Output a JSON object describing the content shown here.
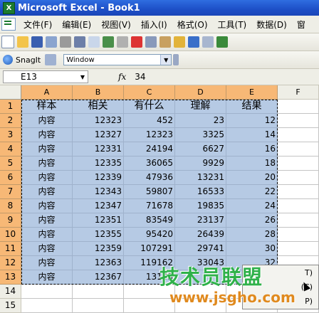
{
  "window": {
    "title": "Microsoft Excel - Book1"
  },
  "menu": [
    "文件(F)",
    "编辑(E)",
    "视图(V)",
    "插入(I)",
    "格式(O)",
    "工具(T)",
    "数据(D)",
    "窗"
  ],
  "snagit": {
    "label": "SnagIt",
    "capture_mode": "Window"
  },
  "formula": {
    "name_box": "E13",
    "fx_label": "fx",
    "value": "34"
  },
  "columns": [
    "A",
    "B",
    "C",
    "D",
    "E",
    "F"
  ],
  "rows": [
    "1",
    "2",
    "3",
    "4",
    "5",
    "6",
    "7",
    "8",
    "9",
    "10",
    "11",
    "12",
    "13",
    "14",
    "15"
  ],
  "table": {
    "headers": [
      "样本",
      "相关",
      "有什么",
      "理解",
      "结果"
    ],
    "data": [
      [
        "内容",
        "12323",
        "452",
        "23",
        "12"
      ],
      [
        "内容",
        "12327",
        "12323",
        "3325",
        "14"
      ],
      [
        "内容",
        "12331",
        "24194",
        "6627",
        "16"
      ],
      [
        "内容",
        "12335",
        "36065",
        "9929",
        "18"
      ],
      [
        "内容",
        "12339",
        "47936",
        "13231",
        "20"
      ],
      [
        "内容",
        "12343",
        "59807",
        "16533",
        "22"
      ],
      [
        "内容",
        "12347",
        "71678",
        "19835",
        "24"
      ],
      [
        "内容",
        "12351",
        "83549",
        "23137",
        "26"
      ],
      [
        "内容",
        "12355",
        "95420",
        "26439",
        "28"
      ],
      [
        "内容",
        "12359",
        "107291",
        "29741",
        "30"
      ],
      [
        "内容",
        "12363",
        "119162",
        "33043",
        "32"
      ],
      [
        "内容",
        "12367",
        "13103",
        "",
        ""
      ]
    ]
  },
  "context_menu": [
    "T)",
    "(C)",
    "P)"
  ],
  "watermark": {
    "main": "技术员联盟",
    "url": "www.jsgho.com"
  },
  "colors": {
    "header_selected": "#f7b876",
    "cell_selected": "#b6cae4",
    "titlebar": "#1d4fc7"
  }
}
